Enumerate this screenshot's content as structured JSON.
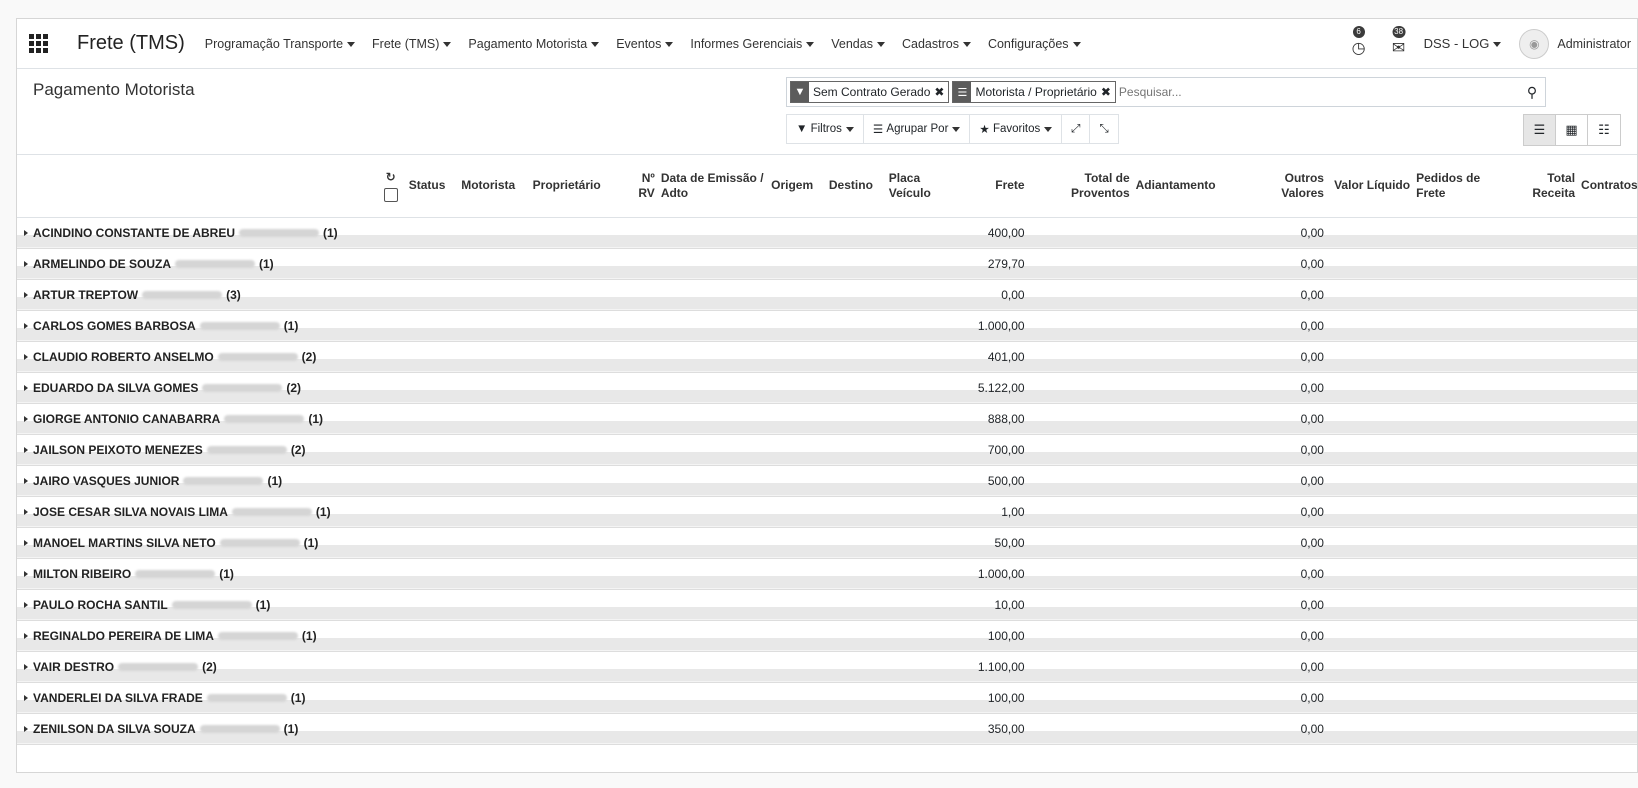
{
  "navbar": {
    "app_title": "Frete (TMS)",
    "menu": [
      "Programação Transporte",
      "Frete (TMS)",
      "Pagamento Motorista",
      "Eventos",
      "Informes Gerenciais",
      "Vendas",
      "Cadastros",
      "Configurações"
    ],
    "activity_badge": "6",
    "messages_badge": "38",
    "company": "DSS - LOG",
    "user": "Administrator"
  },
  "control_panel": {
    "title": "Pagamento Motorista",
    "facets": [
      {
        "label": "Sem Contrato Gerado",
        "icon": "filter-icon"
      },
      {
        "label": "Motorista / Proprietário",
        "icon": "groupby-icon"
      }
    ],
    "search_placeholder": "Pesquisar...",
    "buttons": {
      "filters": "Filtros",
      "group_by": "Agrupar Por",
      "favorites": "Favoritos"
    }
  },
  "table": {
    "columns": {
      "status": "Status",
      "motorista": "Motorista",
      "proprietario": "Proprietário",
      "nrv": "Nº RV",
      "data": "Data de Emissão / Adto",
      "origem": "Origem",
      "destino": "Destino",
      "placa": "Placa Veículo",
      "frete": "Frete",
      "proventos": "Total de Proventos",
      "adiantamento": "Adiantamento",
      "outros": "Outros Valores",
      "liquido": "Valor Líquido",
      "pedidos": "Pedidos de Frete",
      "receita": "Total Receita",
      "contratos": "Contratos"
    },
    "groups": [
      {
        "name": "ACINDINO CONSTANTE DE ABREU",
        "count": "(1)",
        "frete": "400,00",
        "outros": "0,00"
      },
      {
        "name": "ARMELINDO DE SOUZA",
        "count": "(1)",
        "frete": "279,70",
        "outros": "0,00"
      },
      {
        "name": "ARTUR TREPTOW",
        "count": "(3)",
        "frete": "0,00",
        "outros": "0,00"
      },
      {
        "name": "CARLOS GOMES BARBOSA",
        "count": "(1)",
        "frete": "1.000,00",
        "outros": "0,00"
      },
      {
        "name": "CLAUDIO ROBERTO ANSELMO",
        "count": "(2)",
        "frete": "401,00",
        "outros": "0,00"
      },
      {
        "name": "EDUARDO DA SILVA GOMES",
        "count": "(2)",
        "frete": "5.122,00",
        "outros": "0,00"
      },
      {
        "name": "GIORGE ANTONIO CANABARRA",
        "count": "(1)",
        "frete": "888,00",
        "outros": "0,00"
      },
      {
        "name": "JAILSON PEIXOTO MENEZES",
        "count": "(2)",
        "frete": "700,00",
        "outros": "0,00"
      },
      {
        "name": "JAIRO VASQUES JUNIOR",
        "count": "(1)",
        "frete": "500,00",
        "outros": "0,00"
      },
      {
        "name": "JOSE CESAR SILVA NOVAIS LIMA",
        "count": "(1)",
        "frete": "1,00",
        "outros": "0,00"
      },
      {
        "name": "MANOEL MARTINS SILVA NETO",
        "count": "(1)",
        "frete": "50,00",
        "outros": "0,00"
      },
      {
        "name": "MILTON RIBEIRO",
        "count": "(1)",
        "frete": "1.000,00",
        "outros": "0,00"
      },
      {
        "name": "PAULO ROCHA SANTIL",
        "count": "(1)",
        "frete": "10,00",
        "outros": "0,00"
      },
      {
        "name": "REGINALDO PEREIRA DE LIMA",
        "count": "(1)",
        "frete": "100,00",
        "outros": "0,00"
      },
      {
        "name": "VAIR DESTRO",
        "count": "(2)",
        "frete": "1.100,00",
        "outros": "0,00"
      },
      {
        "name": "VANDERLEI DA SILVA FRADE",
        "count": "(1)",
        "frete": "100,00",
        "outros": "0,00"
      },
      {
        "name": "ZENILSON DA SILVA SOUZA",
        "count": "(1)",
        "frete": "350,00",
        "outros": "0,00"
      }
    ]
  }
}
